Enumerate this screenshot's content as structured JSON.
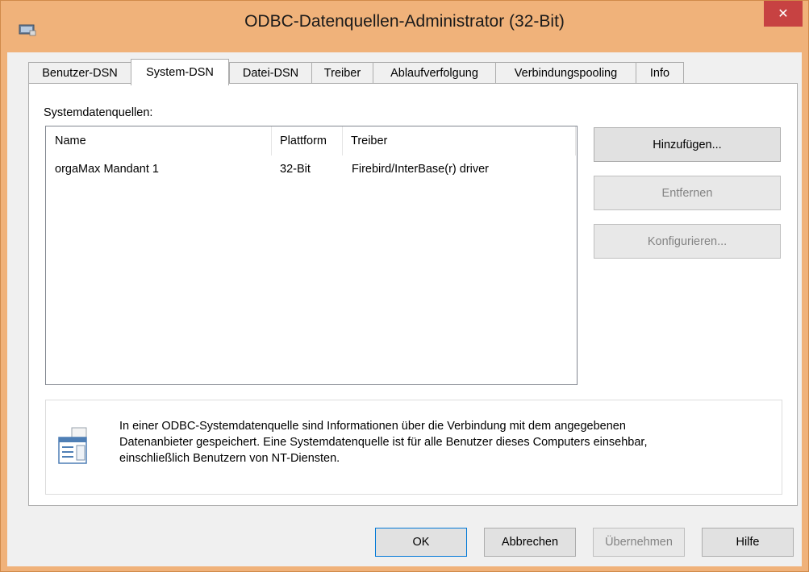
{
  "window": {
    "title": "ODBC-Datenquellen-Administrator (32-Bit)",
    "close_glyph": "✕"
  },
  "tabs": [
    {
      "label": "Benutzer-DSN",
      "active": false
    },
    {
      "label": "System-DSN",
      "active": true
    },
    {
      "label": "Datei-DSN",
      "active": false
    },
    {
      "label": "Treiber",
      "active": false
    },
    {
      "label": "Ablaufverfolgung",
      "active": false
    },
    {
      "label": "Verbindungspooling",
      "active": false
    },
    {
      "label": "Info",
      "active": false
    }
  ],
  "panel": {
    "section_label": "Systemdatenquellen:",
    "columns": [
      "Name",
      "Plattform",
      "Treiber"
    ],
    "rows": [
      {
        "name": "orgaMax Mandant 1",
        "platform": "32-Bit",
        "driver": "Firebird/InterBase(r) driver"
      }
    ],
    "buttons": {
      "add": "Hinzufügen...",
      "remove": "Entfernen",
      "configure": "Konfigurieren..."
    },
    "info_lines": [
      "In einer ODBC-Systemdatenquelle sind Informationen über die Verbindung mit dem angegebenen",
      "Datenanbieter gespeichert. Eine Systemdatenquelle ist für alle Benutzer dieses Computers einsehbar,",
      "einschließlich Benutzern von NT-Diensten."
    ]
  },
  "footer": {
    "ok": "OK",
    "cancel": "Abbrechen",
    "apply": "Übernehmen",
    "help": "Hilfe"
  },
  "colors": {
    "titlebar": "#f0b27a",
    "close": "#c74242",
    "default_border": "#0078d7"
  }
}
